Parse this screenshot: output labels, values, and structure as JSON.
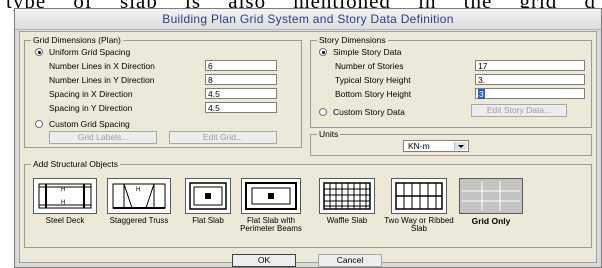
{
  "background": {
    "words": [
      "type",
      "of",
      "slab",
      "is",
      "also",
      "mentioned",
      "in",
      "the",
      "grid",
      "d"
    ]
  },
  "window": {
    "title": "Building Plan Grid System and Story Data Definition"
  },
  "grid_dimensions": {
    "legend": "Grid Dimensions (Plan)",
    "uniform_label": "Uniform Grid Spacing",
    "uniform_selected": true,
    "fields": [
      {
        "label": "Number Lines in X Direction",
        "value": "6"
      },
      {
        "label": "Number Lines in Y Direction",
        "value": "8"
      },
      {
        "label": "Spacing in X Direction",
        "value": "4.5"
      },
      {
        "label": "Spacing in Y Direction",
        "value": "4.5"
      }
    ],
    "custom_label": "Custom Grid Spacing",
    "grid_labels_button": "Grid Labels...",
    "edit_grid_button": "Edit Grid..."
  },
  "story_dimensions": {
    "legend": "Story Dimensions",
    "simple_label": "Simple Story Data",
    "simple_selected": true,
    "fields": [
      {
        "label": "Number of Stories",
        "value": "17"
      },
      {
        "label": "Typical Story Height",
        "value": "3."
      },
      {
        "label": "Bottom Story Height",
        "value": "3"
      }
    ],
    "custom_label": "Custom Story Data",
    "edit_story_button": "Edit Story Data..."
  },
  "units": {
    "legend": "Units",
    "selected": "KN-m"
  },
  "structural_objects": {
    "legend": "Add Structural Objects",
    "items": [
      {
        "label": "Steel Deck",
        "icon": "steel-deck-icon"
      },
      {
        "label": "Staggered Truss",
        "icon": "staggered-truss-icon"
      },
      {
        "label": "Flat Slab",
        "icon": "flat-slab-icon"
      },
      {
        "label": "Flat Slab with Perimeter Beams",
        "icon": "flat-slab-perimeter-icon"
      },
      {
        "label": "Waffle Slab",
        "icon": "waffle-slab-icon"
      },
      {
        "label": "Two Way or Ribbed Slab",
        "icon": "ribbed-slab-icon"
      },
      {
        "label": "Grid Only",
        "icon": "grid-only-icon",
        "selected": true
      }
    ]
  },
  "buttons": {
    "ok": "OK",
    "cancel": "Cancel"
  }
}
